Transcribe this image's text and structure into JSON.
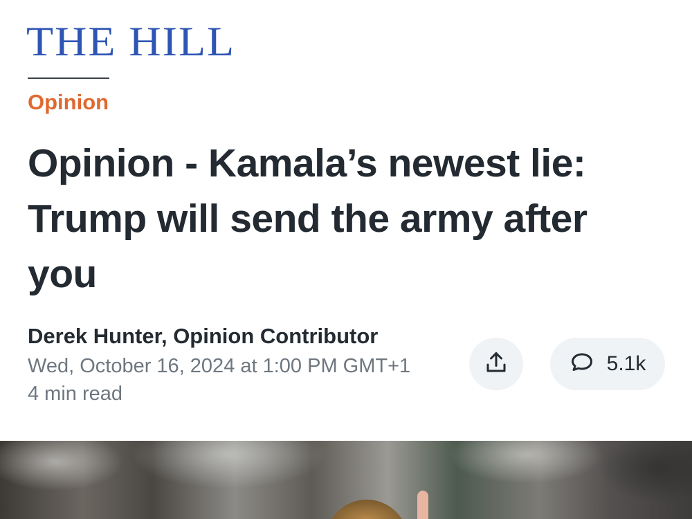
{
  "brand": {
    "logo_text": "THE HILL",
    "logo_color": "#2f55b4"
  },
  "article": {
    "category": "Opinion",
    "category_color": "#e0692f",
    "headline": "Opinion - Kamala’s newest lie: Trump will send the army after you",
    "byline": "Derek Hunter, Opinion Contributor",
    "date": "Wed, October 16, 2024 at 1:00 PM GMT+1",
    "read_time": "4 min read"
  },
  "actions": {
    "share_icon": "share-icon",
    "comments_icon": "comment-bubble-icon",
    "comments_count": "5.1k"
  }
}
